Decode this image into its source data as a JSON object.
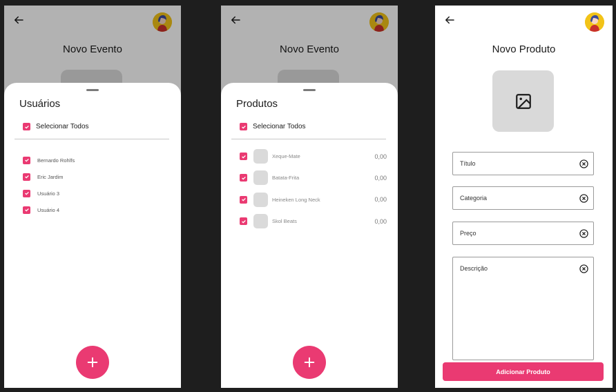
{
  "screen_users": {
    "header_title": "Novo Evento",
    "sheet_title": "Usuários",
    "select_all_label": "Selecionar Todos",
    "users": [
      {
        "name": "Bernardo Rohlfs"
      },
      {
        "name": "Eric Jardim"
      },
      {
        "name": "Usuário 3"
      },
      {
        "name": "Usuário 4"
      }
    ]
  },
  "screen_products": {
    "header_title": "Novo Evento",
    "sheet_title": "Produtos",
    "select_all_label": "Selecionar Todos",
    "products": [
      {
        "name": "Xeque-Mate",
        "price": "0,00"
      },
      {
        "name": "Batata-Frita",
        "price": "0,00"
      },
      {
        "name": "Heineken Long Neck",
        "price": "0,00"
      },
      {
        "name": "Skol Beats",
        "price": "0,00"
      }
    ]
  },
  "screen_new_product": {
    "header_title": "Novo Produto",
    "fields": {
      "title_label": "Título",
      "category_label": "Categoria",
      "price_label": "Preço",
      "description_label": "Descrição"
    },
    "submit_label": "Adicionar Produto"
  },
  "icons": {
    "back": "arrow-left-icon",
    "clear": "x-circle-icon",
    "image": "image-icon",
    "add": "plus-icon",
    "check": "check-icon"
  },
  "colors": {
    "accent": "#ea3a72",
    "background": "#1e1e1e",
    "placeholder": "#d9d9d9"
  }
}
